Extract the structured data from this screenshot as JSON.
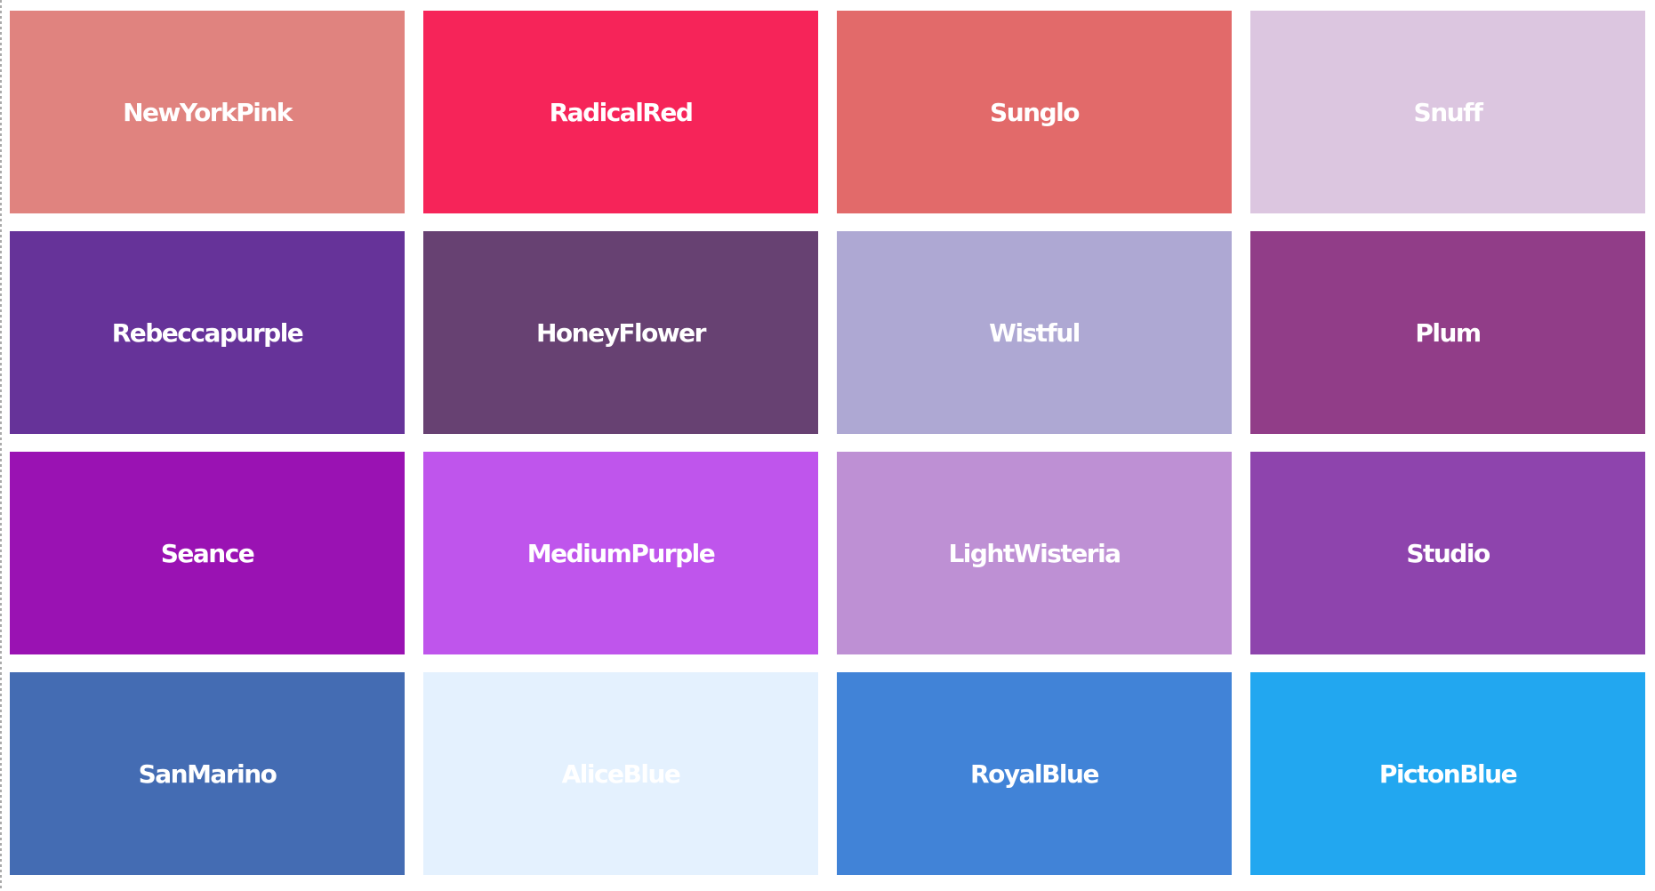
{
  "swatches": [
    {
      "name": "NewYorkPink",
      "color": "#e0837f"
    },
    {
      "name": "RadicalRed",
      "color": "#f62459"
    },
    {
      "name": "Sunglo",
      "color": "#e26a6a"
    },
    {
      "name": "Snuff",
      "color": "#dcc6e0"
    },
    {
      "name": "Rebeccapurple",
      "color": "#663399"
    },
    {
      "name": "HoneyFlower",
      "color": "#674172"
    },
    {
      "name": "Wistful",
      "color": "#aea8d3"
    },
    {
      "name": "Plum",
      "color": "#913d88"
    },
    {
      "name": "Seance",
      "color": "#9a12b3"
    },
    {
      "name": "MediumPurple",
      "color": "#bf55ec"
    },
    {
      "name": "LightWisteria",
      "color": "#be90d4"
    },
    {
      "name": "Studio",
      "color": "#8e44ad"
    },
    {
      "name": "SanMarino",
      "color": "#446cb3"
    },
    {
      "name": "AliceBlue",
      "color": "#e4f1fe"
    },
    {
      "name": "RoyalBlue",
      "color": "#4183d7"
    },
    {
      "name": "PictonBlue",
      "color": "#22a7f0"
    }
  ]
}
